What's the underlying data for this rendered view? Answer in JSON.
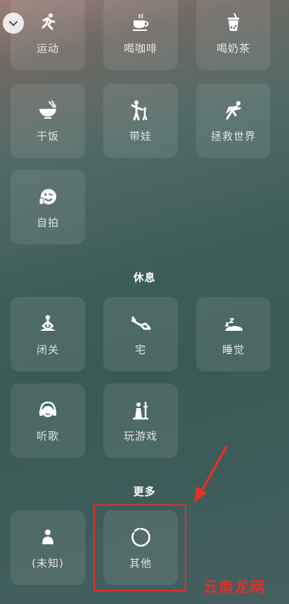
{
  "sections": {
    "rest_title": "休息",
    "more_title": "更多"
  },
  "tiles": {
    "sport": "运动",
    "coffee": "喝咖啡",
    "milktea": "喝奶茶",
    "eat": "干饭",
    "baby": "带娃",
    "save_world": "拯救世界",
    "selfie": "自拍",
    "retreat": "闭关",
    "home": "宅",
    "sleep": "睡觉",
    "music": "听歌",
    "game": "玩游戏",
    "unknown": "(未知)",
    "other": "其他"
  },
  "watermark": "云南龙网",
  "colors": {
    "highlight": "#e0302a",
    "tile_bg": "rgba(255,255,255,0.09)"
  }
}
